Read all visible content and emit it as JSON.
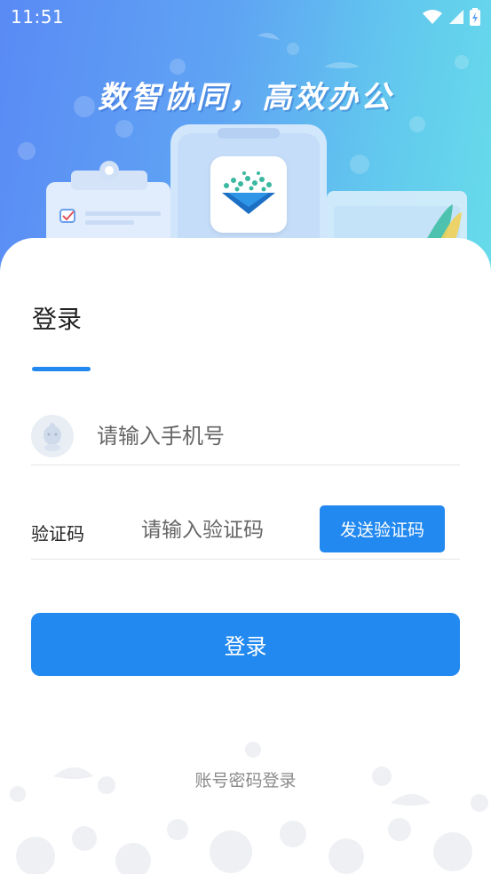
{
  "status_bar": {
    "time": "11:51"
  },
  "hero": {
    "slogan": "数智协同，高效办公"
  },
  "login": {
    "title": "登录",
    "phone_placeholder": "请输入手机号",
    "code_label": "验证码",
    "code_placeholder": "请输入验证码",
    "send_code_label": "发送验证码",
    "submit_label": "登录",
    "alt_login_label": "账号密码登录"
  },
  "colors": {
    "accent": "#2289f0",
    "hero_start": "#5a8af5",
    "hero_end": "#67dcea",
    "muted_text": "#8a8a8a"
  },
  "icons": [
    "wifi-icon",
    "signal-icon",
    "battery-icon",
    "avatar-icon",
    "app-logo-icon"
  ]
}
